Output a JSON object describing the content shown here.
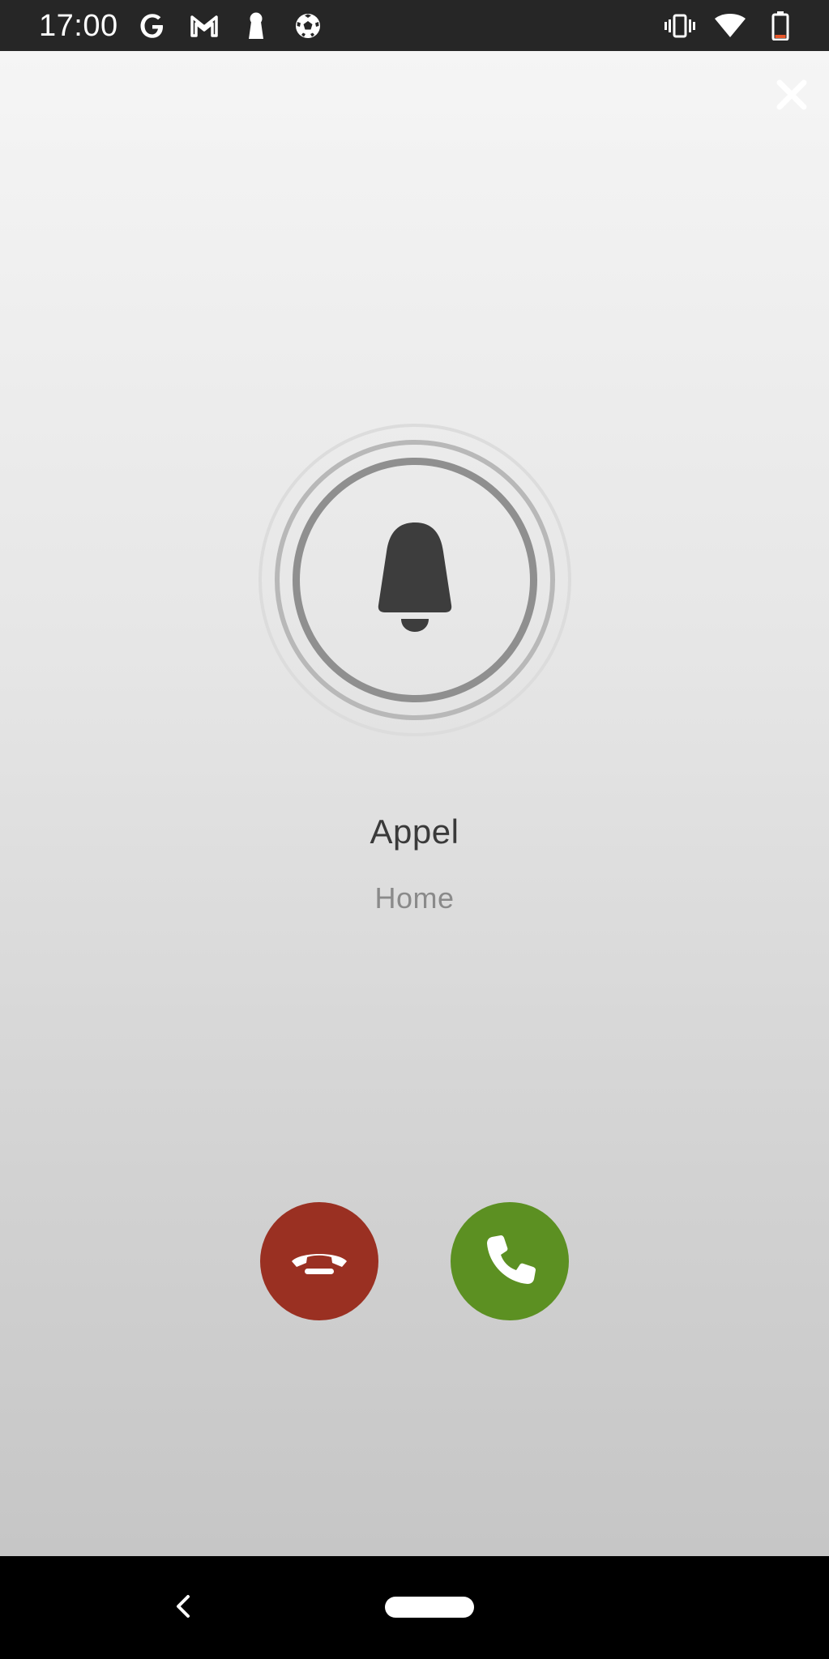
{
  "status_bar": {
    "time": "17:00",
    "left_icons": [
      "google-icon",
      "gmail-icon",
      "keyhole-icon",
      "soccer-ball-icon"
    ],
    "right_icons": [
      "vibrate-icon",
      "wifi-icon",
      "battery-icon"
    ]
  },
  "call": {
    "title": "Appel",
    "subtitle": "Home",
    "icon": "bell-icon"
  },
  "actions": {
    "decline_icon": "hang-up-icon",
    "accept_icon": "phone-icon"
  },
  "colors": {
    "status_bar_bg": "#262626",
    "decline": "#9a3022",
    "accept": "#5c9022",
    "bell": "#3d3d3d",
    "title_text": "#3a3a3a",
    "subtitle_text": "#8a8a8a"
  },
  "navigation": {
    "back_icon": "chevron-left-icon",
    "home_icon": "home-pill-icon"
  }
}
